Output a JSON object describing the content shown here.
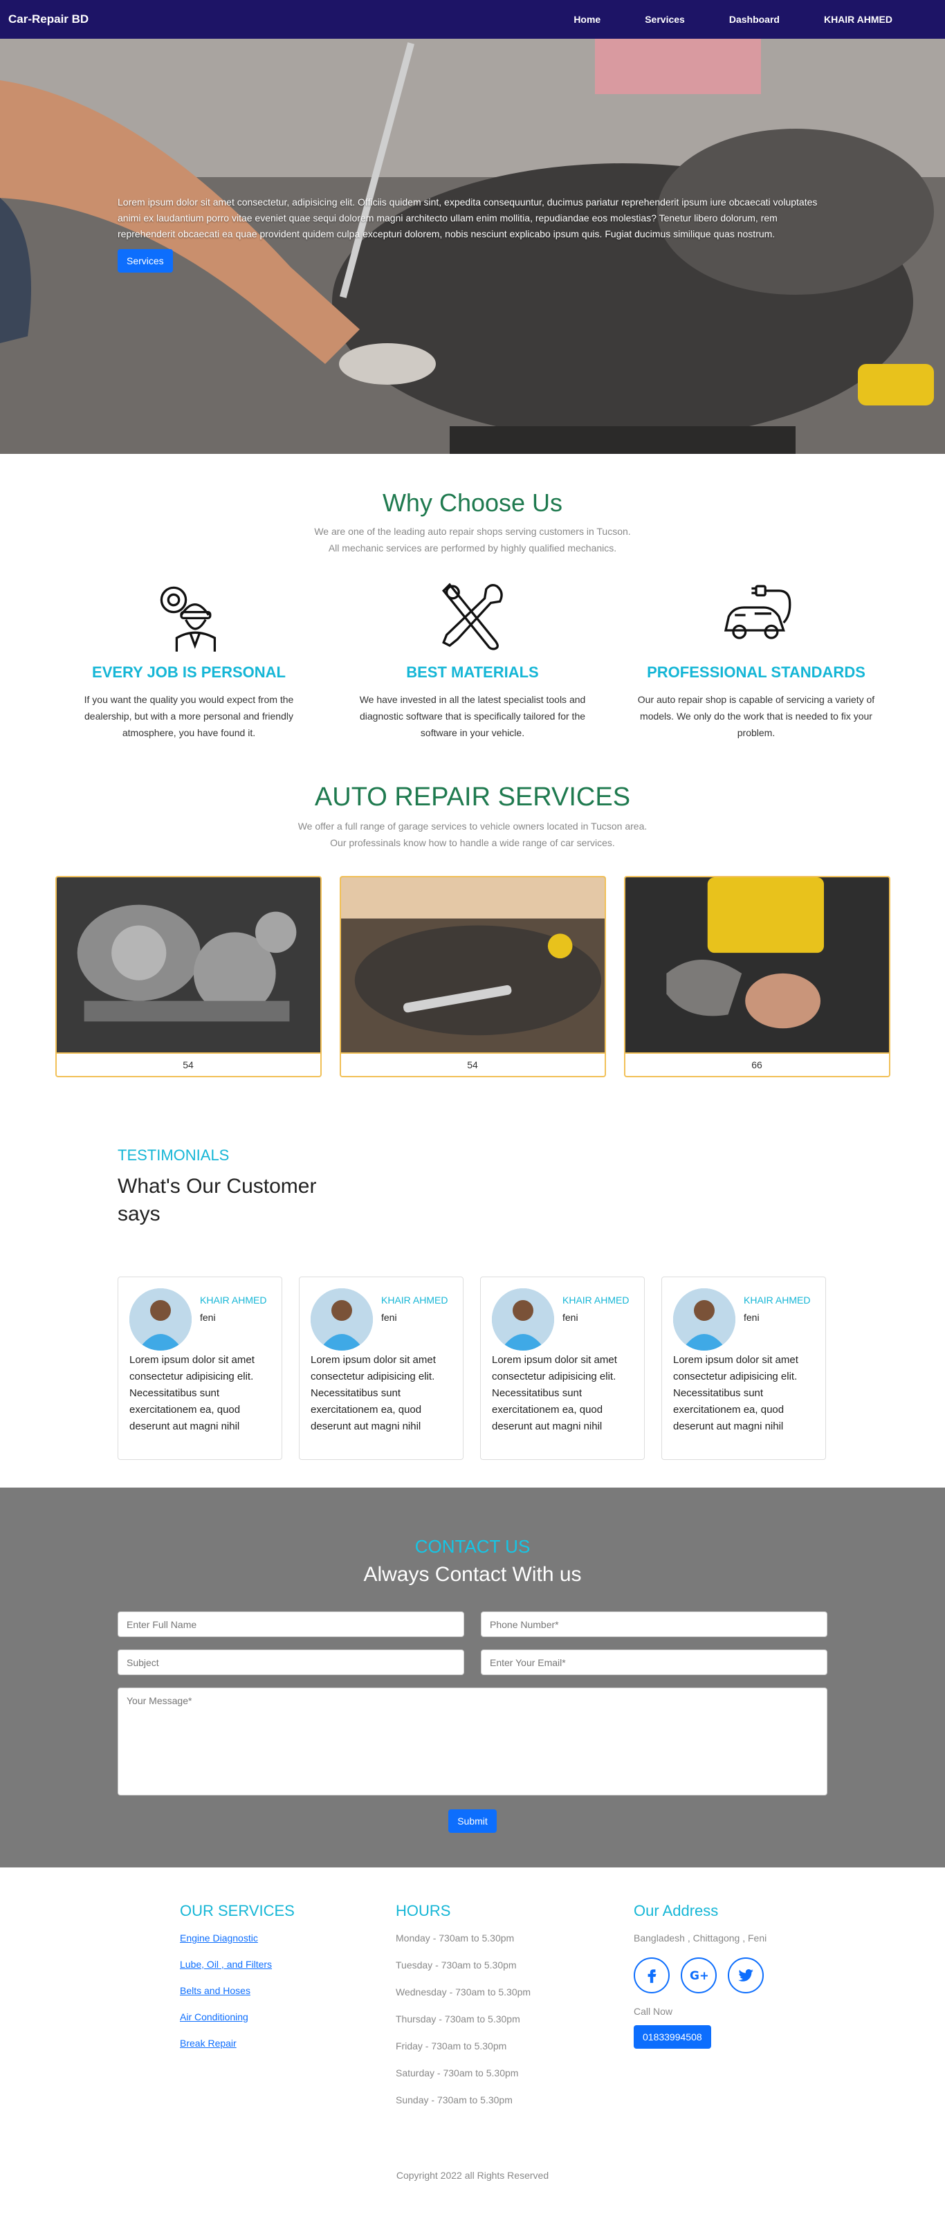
{
  "nav": {
    "brand": "Car-Repair BD",
    "links": [
      "Home",
      "Services",
      "Dashboard",
      "KHAIR AHMED"
    ]
  },
  "hero": {
    "text": "Lorem ipsum dolor sit amet consectetur, adipisicing elit. Officiis quidem sint, expedita consequuntur, ducimus pariatur reprehenderit ipsum iure obcaecati voluptates animi ex laudantium porro vitae eveniet quae sequi dolorem magni architecto ullam enim mollitia, repudiandae eos molestias? Tenetur libero dolorum, rem reprehenderit obcaecati ea quae provident quidem culpa excepturi dolorem, nobis nesciunt explicabo ipsum quis. Fugiat ducimus similique quas nostrum.",
    "button": "Services"
  },
  "why": {
    "title": "Why Choose Us",
    "sub1": "We are one of the leading auto repair shops serving customers in Tucson.",
    "sub2": "All mechanic services are performed by highly qualified mechanics.",
    "features": [
      {
        "title": "EVERY JOB IS PERSONAL",
        "icon": "mechanic-icon",
        "text": "If you want the quality you would expect from the dealership, but with a more personal and friendly atmosphere, you have found it."
      },
      {
        "title": "BEST MATERIALS",
        "icon": "tools-icon",
        "text": "We have invested in all the latest specialist tools and diagnostic software that is specifically tailored for the software in your vehicle."
      },
      {
        "title": "PROFESSIONAL STANDARDS",
        "icon": "electric-car-icon",
        "text": "Our auto repair shop is capable of servicing a variety of models. We only do the work that is needed to fix your problem."
      }
    ]
  },
  "services": {
    "title": "AUTO REPAIR SERVICES",
    "sub1": "We offer a full range of garage services to vehicle owners located in Tucson area.",
    "sub2": "Our professinals know how to handle a wide range of car services.",
    "cards": [
      {
        "label": "54"
      },
      {
        "label": "54"
      },
      {
        "label": "66"
      }
    ]
  },
  "testimonials": {
    "kicker": "TESTIMONIALS",
    "title": "What's Our Customer says",
    "items": [
      {
        "name": "KHAIR AHMED",
        "city": "feni",
        "text": "Lorem ipsum dolor sit amet consectetur adipisicing elit. Necessitatibus sunt exercitationem ea, quod deserunt aut magni nihil"
      },
      {
        "name": "KHAIR AHMED",
        "city": "feni",
        "text": "Lorem ipsum dolor sit amet consectetur adipisicing elit. Necessitatibus sunt exercitationem ea, quod deserunt aut magni nihil"
      },
      {
        "name": "KHAIR AHMED",
        "city": "feni",
        "text": "Lorem ipsum dolor sit amet consectetur adipisicing elit. Necessitatibus sunt exercitationem ea, quod deserunt aut magni nihil"
      },
      {
        "name": "KHAIR AHMED",
        "city": "feni",
        "text": "Lorem ipsum dolor sit amet consectetur adipisicing elit. Necessitatibus sunt exercitationem ea, quod deserunt aut magni nihil"
      }
    ]
  },
  "contact": {
    "kicker": "CONTACT US",
    "title": "Always Contact With us",
    "placeholders": {
      "name": "Enter Full Name",
      "phone": "Phone Number*",
      "subject": "Subject",
      "email": "Enter Your Email*",
      "message": "Your Message*"
    },
    "submit": "Submit"
  },
  "footer": {
    "services_title": "OUR SERVICES",
    "services": [
      "Engine Diagnostic",
      "Lube, Oil , and Filters",
      "Belts and Hoses",
      "Air Conditioning",
      "Break Repair"
    ],
    "hours_title": "HOURS",
    "hours": [
      "Monday - 730am to 5.30pm",
      "Tuesday - 730am to 5.30pm",
      "Wednesday - 730am to 5.30pm",
      "Thursday - 730am to 5.30pm",
      "Friday - 730am to 5.30pm",
      "Saturday - 730am to 5.30pm",
      "Sunday - 730am to 5.30pm"
    ],
    "address_title": "Our Address",
    "address": "Bangladesh , Chittagong , Feni",
    "call_label": "Call Now",
    "phone": "01833994508",
    "copyright": "Copyright 2022 all Rights Reserved"
  }
}
